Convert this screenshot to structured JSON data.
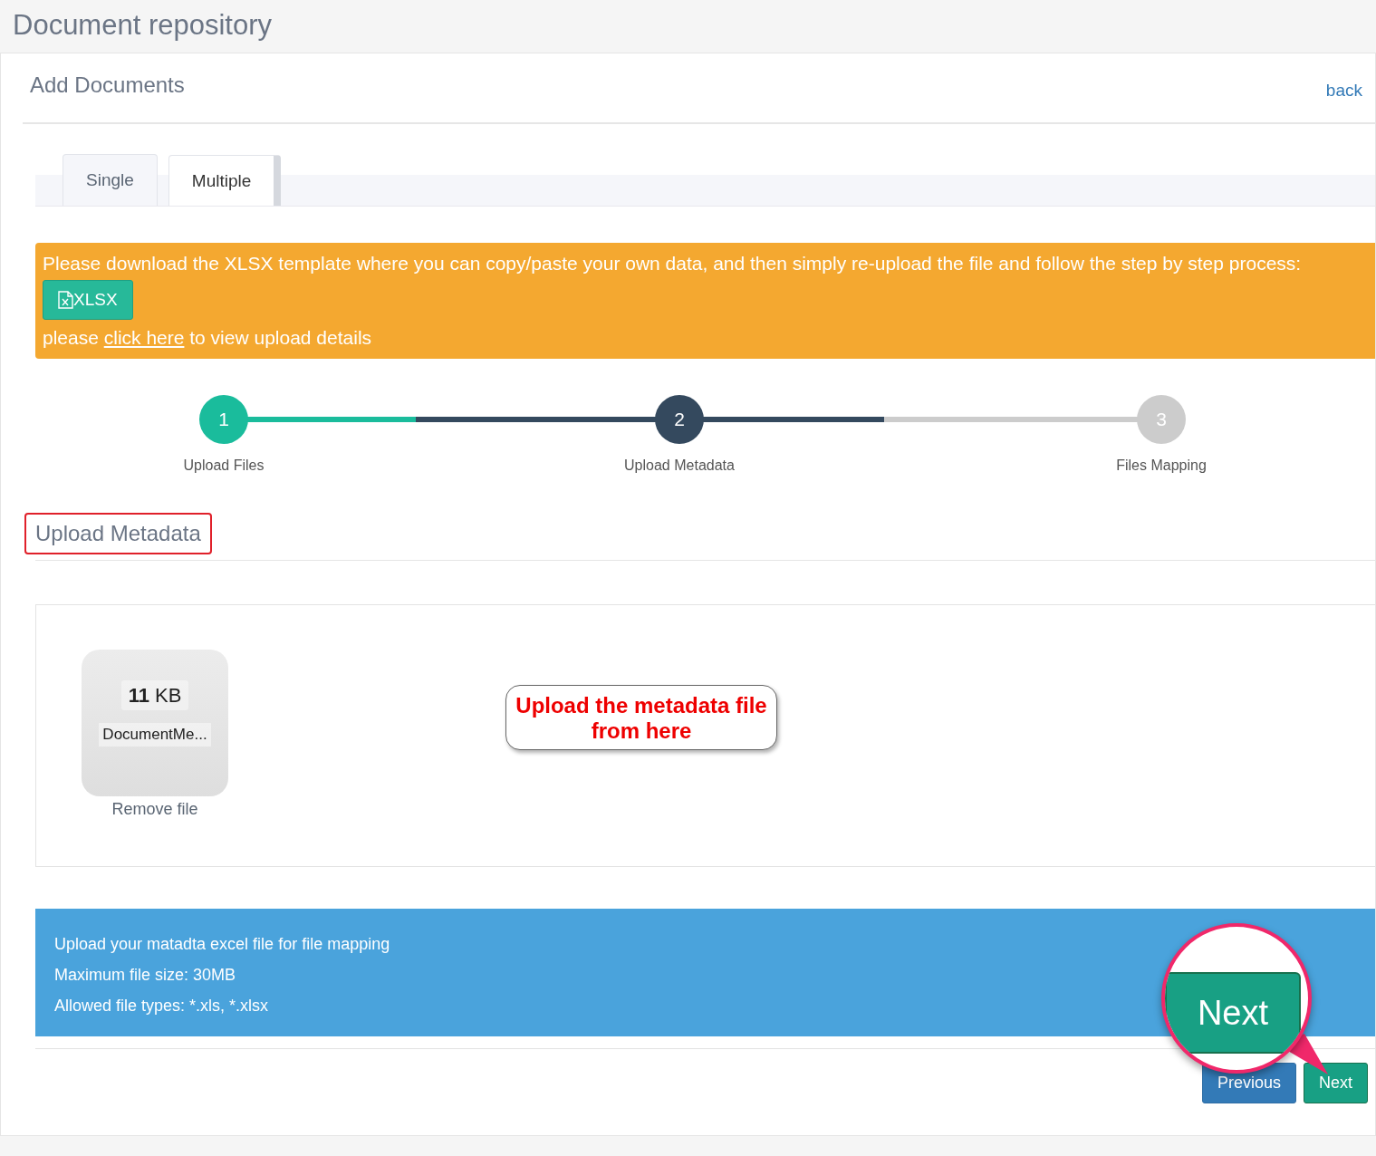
{
  "page_title": "Document repository",
  "panel": {
    "title": "Add Documents",
    "back_link": "back"
  },
  "tabs": [
    {
      "label": "Single",
      "selected": false
    },
    {
      "label": "Multiple",
      "selected": true
    }
  ],
  "notice": {
    "text": "Please download the XLSX template where you can copy/paste your own data, and then simply re-upload the file and follow the step by step process:",
    "button": "XLSX",
    "details_before": "please ",
    "details_link": "click here",
    "details_after": " to view upload details"
  },
  "steps": [
    {
      "number": "1",
      "label": "Upload Files",
      "completed": true,
      "selected": false
    },
    {
      "number": "2",
      "label": "Upload Metadata",
      "completed": false,
      "selected": true
    },
    {
      "number": "3",
      "label": "Files Mapping",
      "completed": false,
      "selected": false
    }
  ],
  "section": {
    "title": "Upload Metadata",
    "highlighted": true
  },
  "file": {
    "size_number": "11",
    "size_unit": "KB",
    "name": "DocumentMe...",
    "remove": "Remove file"
  },
  "callout": "Upload the metadata file from here",
  "info": [
    "Upload your matadta excel file for file mapping",
    "Maximum file size: 30MB",
    "Allowed file types: *.xls, *.xlsx"
  ],
  "buttons": [
    {
      "label": "Previous",
      "kind": "secondary"
    },
    {
      "label": "Next",
      "kind": "primary"
    }
  ],
  "magnifier": {
    "label": "Next"
  }
}
